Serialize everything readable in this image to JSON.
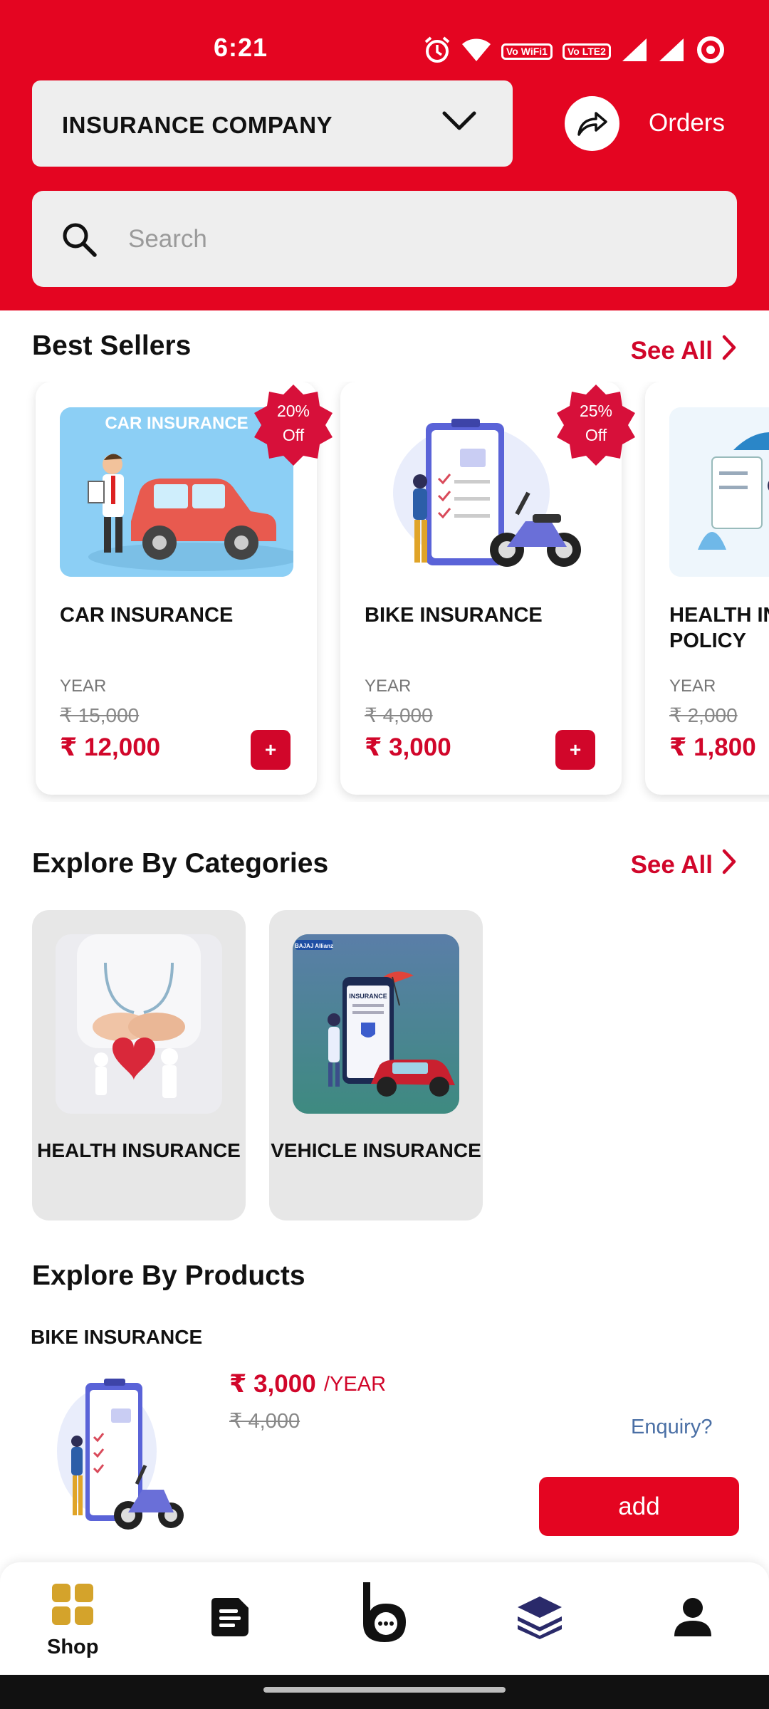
{
  "status_bar": {
    "time": "6:21",
    "wifi_chip": "Vo WiFi1",
    "lte_chip": "Vo LTE2"
  },
  "header": {
    "company_select": {
      "label": "INSURANCE COMPANY"
    },
    "orders_label": "Orders"
  },
  "search": {
    "placeholder": "Search",
    "value": ""
  },
  "best_sellers": {
    "title": "Best Sellers",
    "see_all": "See All",
    "items": [
      {
        "image_title": "CAR INSURANCE",
        "name": "CAR INSURANCE",
        "period": "YEAR",
        "mrp": "₹ 15,000",
        "price": "₹ 12,000",
        "badge_pct": "20%",
        "badge_off": "Off",
        "add": "+"
      },
      {
        "name": "BIKE INSURANCE",
        "period": "YEAR",
        "mrp": "₹ 4,000",
        "price": "₹ 3,000",
        "badge_pct": "25%",
        "badge_off": "Off",
        "add": "+"
      },
      {
        "name": "HEALTH INSURANCE POLICY",
        "period": "YEAR",
        "mrp": "₹ 2,000",
        "price": "₹ 1,800"
      }
    ]
  },
  "categories": {
    "title": "Explore By Categories",
    "see_all": "See All",
    "items": [
      {
        "label": "HEALTH INSURANCE"
      },
      {
        "label": "VEHICLE INSURANCE",
        "image_chip": "BAJAJ Allianz",
        "image_text": "INSURANCE"
      }
    ]
  },
  "products": {
    "title": "Explore By Products",
    "items": [
      {
        "category": "BIKE INSURANCE",
        "price": "₹ 3,000",
        "unit": "/YEAR",
        "mrp": "₹ 4,000",
        "enquiry": "Enquiry?",
        "add": "add"
      }
    ]
  },
  "bottom_nav": {
    "items": [
      {
        "label": "Shop",
        "icon": "grid-icon",
        "active": true
      },
      {
        "icon": "notes-icon"
      },
      {
        "icon": "chat-logo-icon"
      },
      {
        "icon": "layers-icon"
      },
      {
        "icon": "user-icon"
      }
    ]
  },
  "colors": {
    "brand_red": "#e40521",
    "price_red": "#d1062a",
    "shop_icon_gold": "#d4a32b",
    "layers_navy": "#2a2a6a",
    "enquiry_blue": "#4a6fa5"
  }
}
